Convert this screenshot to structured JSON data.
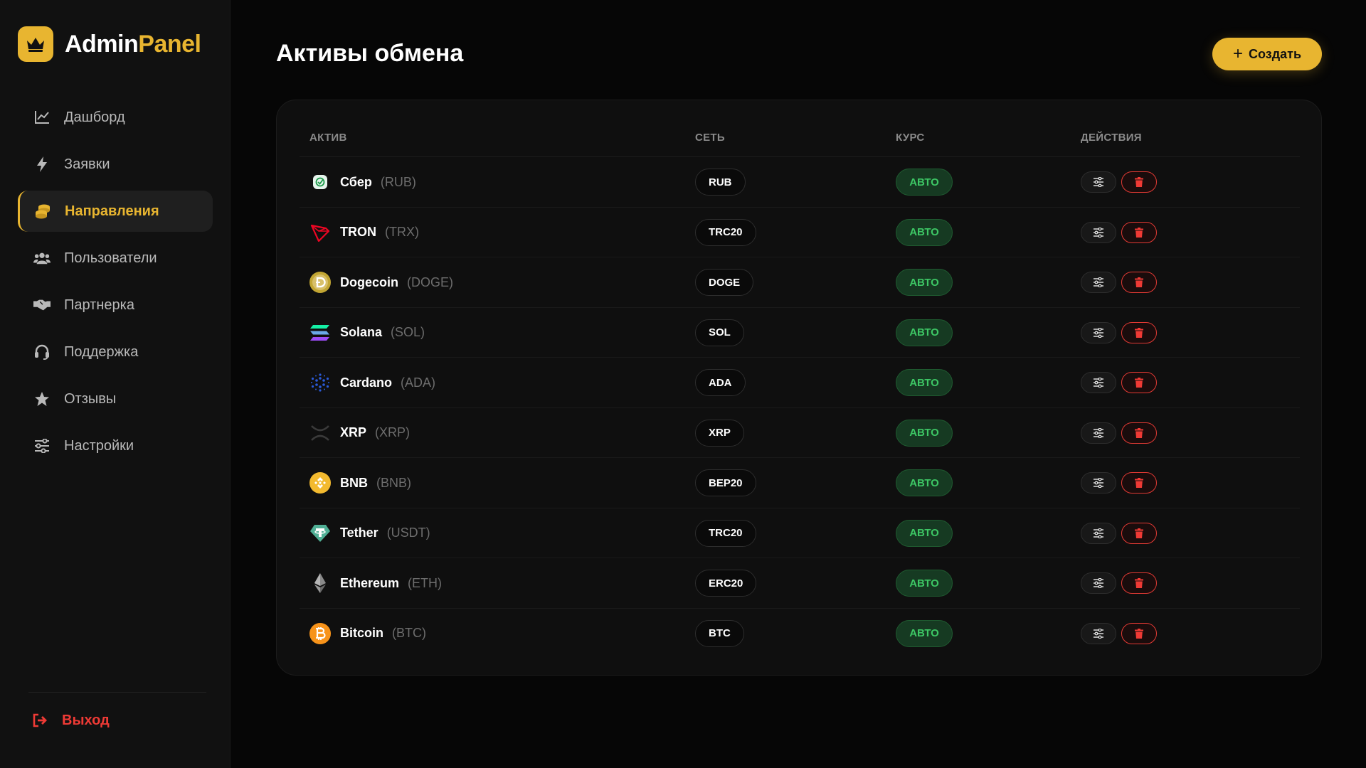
{
  "brand": {
    "name_part1": "Admin",
    "name_part2": "Panel",
    "accent": "#e8b530"
  },
  "sidebar": {
    "items": [
      {
        "label": "Дашборд",
        "icon": "chart-line-icon"
      },
      {
        "label": "Заявки",
        "icon": "bolt-icon"
      },
      {
        "label": "Направления",
        "icon": "coins-icon",
        "active": true
      },
      {
        "label": "Пользователи",
        "icon": "users-icon"
      },
      {
        "label": "Партнерка",
        "icon": "handshake-icon"
      },
      {
        "label": "Поддержка",
        "icon": "headset-icon"
      },
      {
        "label": "Отзывы",
        "icon": "star-icon"
      },
      {
        "label": "Настройки",
        "icon": "sliders-icon"
      }
    ],
    "logout": {
      "label": "Выход",
      "icon": "sign-out-icon",
      "color": "#ef3a35"
    }
  },
  "page": {
    "title": "Активы обмена",
    "create_label": "Создать"
  },
  "table": {
    "headers": {
      "asset": "АКТИВ",
      "network": "СЕТЬ",
      "rate": "КУРС",
      "actions": "ДЕЙСТВИЯ"
    },
    "rows": [
      {
        "name": "Сбер",
        "code": "(RUB)",
        "network": "RUB",
        "rate": "АВТО",
        "icon": "sber-icon"
      },
      {
        "name": "TRON",
        "code": "(TRX)",
        "network": "TRC20",
        "rate": "АВТО",
        "icon": "tron-icon"
      },
      {
        "name": "Dogecoin",
        "code": "(DOGE)",
        "network": "DOGE",
        "rate": "АВТО",
        "icon": "dogecoin-icon"
      },
      {
        "name": "Solana",
        "code": "(SOL)",
        "network": "SOL",
        "rate": "АВТО",
        "icon": "solana-icon"
      },
      {
        "name": "Cardano",
        "code": "(ADA)",
        "network": "ADA",
        "rate": "АВТО",
        "icon": "cardano-icon"
      },
      {
        "name": "XRP",
        "code": "(XRP)",
        "network": "XRP",
        "rate": "АВТО",
        "icon": "xrp-icon"
      },
      {
        "name": "BNB",
        "code": "(BNB)",
        "network": "BEP20",
        "rate": "АВТО",
        "icon": "bnb-icon"
      },
      {
        "name": "Tether",
        "code": "(USDT)",
        "network": "TRC20",
        "rate": "АВТО",
        "icon": "tether-icon"
      },
      {
        "name": "Ethereum",
        "code": "(ETH)",
        "network": "ERC20",
        "rate": "АВТО",
        "icon": "ethereum-icon"
      },
      {
        "name": "Bitcoin",
        "code": "(BTC)",
        "network": "BTC",
        "rate": "АВТО",
        "icon": "bitcoin-icon"
      }
    ]
  },
  "colors": {
    "rate_text": "#3dc765",
    "delete": "#e23a34",
    "background": "#060606",
    "card": "#0f0f0f"
  }
}
